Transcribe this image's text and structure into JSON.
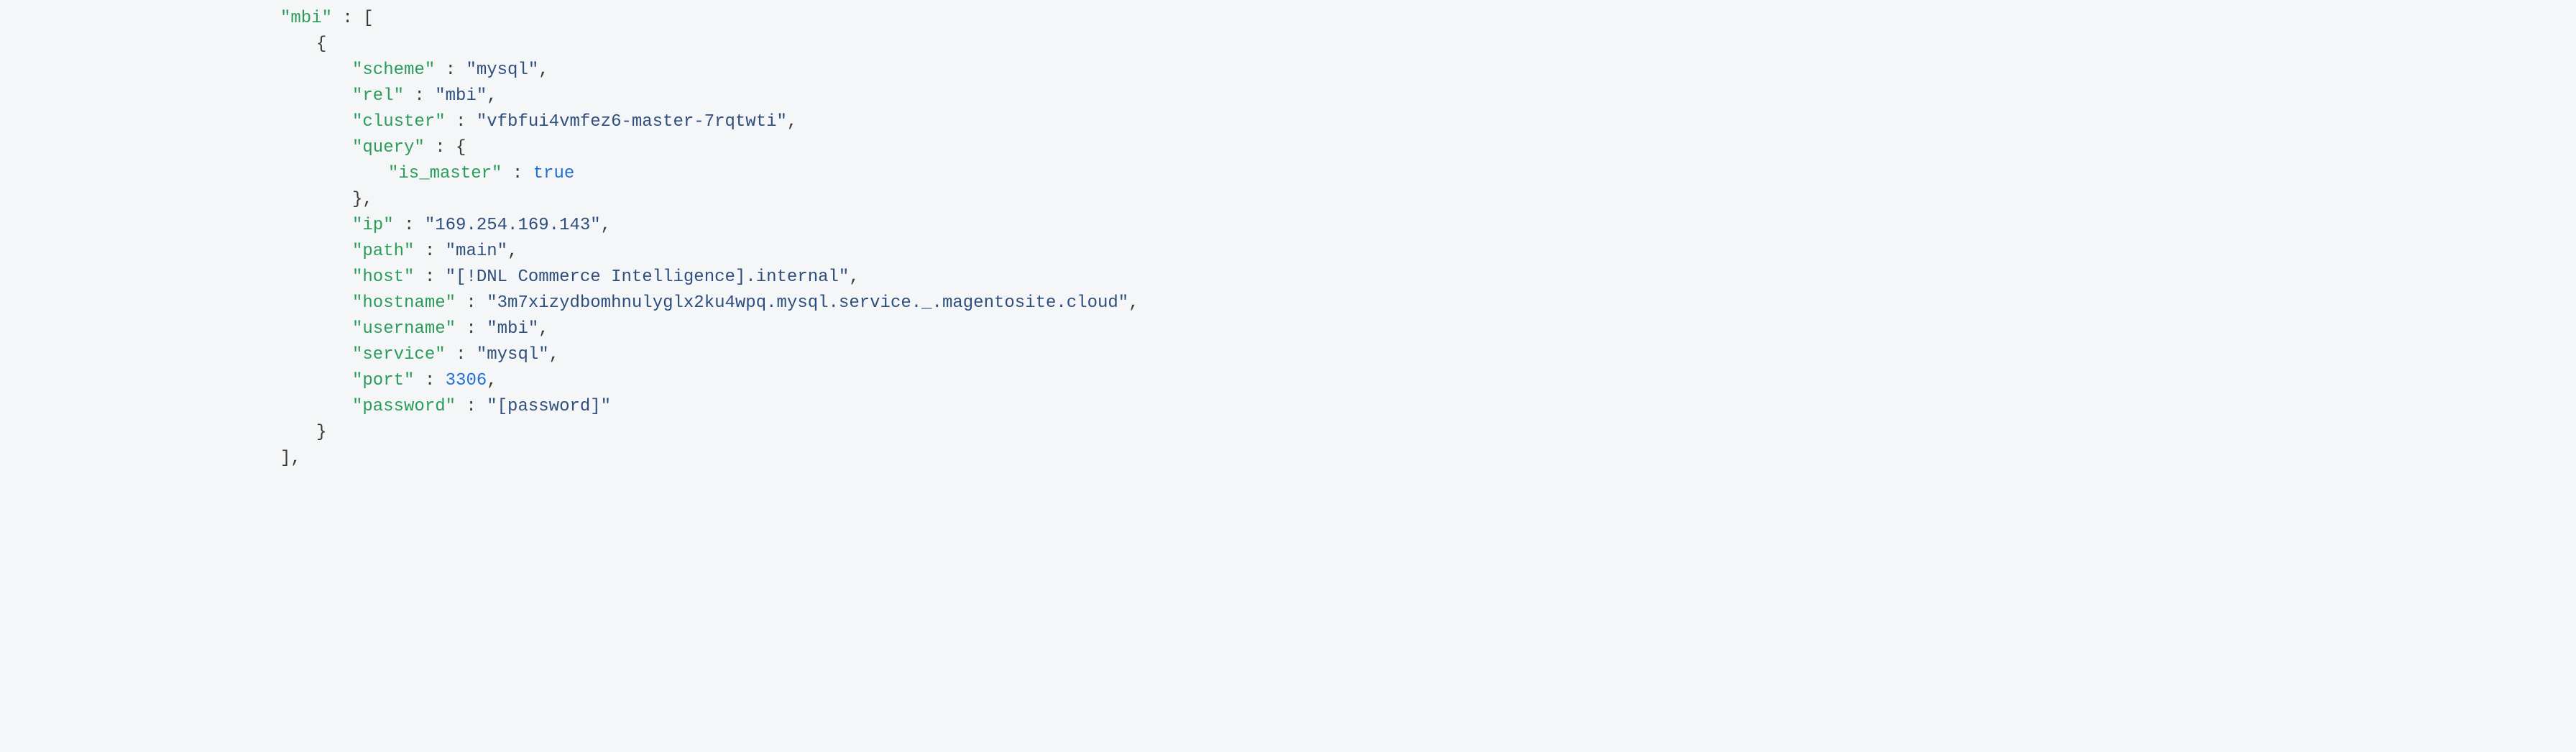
{
  "code": {
    "rootKey": "mbi",
    "items": [
      {
        "key": "scheme",
        "kind": "str",
        "value": "mysql"
      },
      {
        "key": "rel",
        "kind": "str",
        "value": "mbi"
      },
      {
        "key": "cluster",
        "kind": "str",
        "value": "vfbfui4vmfez6-master-7rqtwti"
      },
      {
        "key": "query",
        "kind": "obj",
        "children": [
          {
            "key": "is_master",
            "kind": "bool",
            "value": "true"
          }
        ]
      },
      {
        "key": "ip",
        "kind": "str",
        "value": "169.254.169.143"
      },
      {
        "key": "path",
        "kind": "str",
        "value": "main"
      },
      {
        "key": "host",
        "kind": "str",
        "value": "[!DNL Commerce Intelligence].internal"
      },
      {
        "key": "hostname",
        "kind": "str",
        "value": "3m7xizydbomhnulyglx2ku4wpq.mysql.service._.magentosite.cloud"
      },
      {
        "key": "username",
        "kind": "str",
        "value": "mbi"
      },
      {
        "key": "service",
        "kind": "str",
        "value": "mysql"
      },
      {
        "key": "port",
        "kind": "num",
        "value": "3306"
      },
      {
        "key": "password",
        "kind": "str",
        "value": "[password]"
      }
    ]
  }
}
